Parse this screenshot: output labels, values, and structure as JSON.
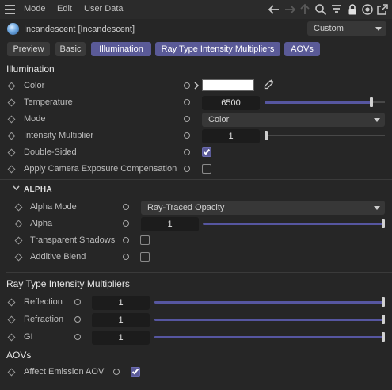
{
  "menubar": {
    "items": [
      "Mode",
      "Edit",
      "User Data"
    ]
  },
  "object": {
    "name": "Incandescent [Incandescent]",
    "preset": "Custom"
  },
  "tabs": [
    {
      "label": "Preview",
      "active": false
    },
    {
      "label": "Basic",
      "active": false
    },
    {
      "label": "Illumination",
      "active": true
    },
    {
      "label": "Ray Type Intensity Multipliers",
      "active": true
    },
    {
      "label": "AOVs",
      "active": true
    }
  ],
  "illumination": {
    "title": "Illumination",
    "color": {
      "label": "Color",
      "value": "#ffffff"
    },
    "temperature": {
      "label": "Temperature",
      "value": "6500",
      "fraction": 0.9
    },
    "mode": {
      "label": "Mode",
      "value": "Color"
    },
    "intensity": {
      "label": "Intensity Multiplier",
      "value": "1",
      "fraction": 0.0
    },
    "double_sided": {
      "label": "Double-Sided",
      "checked": true
    },
    "exposure": {
      "label": "Apply Camera Exposure Compensation",
      "checked": false
    }
  },
  "alpha": {
    "title": "ALPHA",
    "mode": {
      "label": "Alpha Mode",
      "value": "Ray-Traced Opacity"
    },
    "alpha": {
      "label": "Alpha",
      "value": "1",
      "fraction": 1.0
    },
    "transparent_shadows": {
      "label": "Transparent Shadows",
      "checked": false
    },
    "additive_blend": {
      "label": "Additive Blend",
      "checked": false
    }
  },
  "ray_type": {
    "title": "Ray Type Intensity Multipliers",
    "reflection": {
      "label": "Reflection",
      "value": "1",
      "fraction": 1.0
    },
    "refraction": {
      "label": "Refraction",
      "value": "1",
      "fraction": 1.0
    },
    "gi": {
      "label": "GI",
      "value": "1",
      "fraction": 1.0
    }
  },
  "aovs": {
    "title": "AOVs",
    "affect_emission": {
      "label": "Affect Emission AOV",
      "checked": true
    }
  },
  "colors": {
    "accent": "#5a5a97",
    "background": "#262626"
  }
}
